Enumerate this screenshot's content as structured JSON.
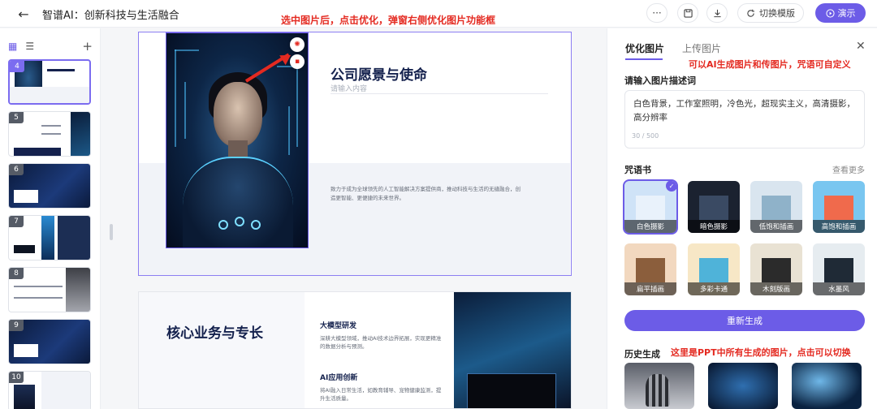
{
  "header": {
    "title": "智谱AI：创新科技与生活融合",
    "more_icon": "···",
    "switch_label": "切换模版",
    "present_label": "演示"
  },
  "annotations": {
    "top": "选中图片后，点击优化，弹窗右侧优化图片功能框",
    "right": "可以AI生成图片和传图片，咒语可自定义",
    "history": "这里是PPT中所有生成的图片，点击可以切换"
  },
  "thumbnails": [
    {
      "num": "4"
    },
    {
      "num": "5"
    },
    {
      "num": "6"
    },
    {
      "num": "7"
    },
    {
      "num": "8"
    },
    {
      "num": "9"
    },
    {
      "num": "10"
    }
  ],
  "slide1": {
    "title": "公司愿景与使命",
    "input_placeholder": "请输入内容",
    "description": "致力于成为全球领先的人工智能解决方案提供商，推动科技与生活的无缝融合，创造更智能、更便捷的未来世界。"
  },
  "slide2": {
    "title": "核心业务与专长",
    "item1_title": "大模型研发",
    "item1_text": "深耕大模型领域，推动AI技术边界拓展，实现更精准的数据分析与预测。",
    "item2_title": "AI应用创新",
    "item2_text": "将AI融入日常生活，如教育辅导、宠物健康监测，提升生活质量。"
  },
  "panel": {
    "tab_optimize": "优化图片",
    "tab_upload": "上传图片",
    "desc_label": "请输入图片描述词",
    "desc_value": "白色背景，工作室照明，冷色光，超现实主义，高清摄影，高分辨率",
    "counter": "30 / 500",
    "spellbook_label": "咒语书",
    "see_more": "查看更多",
    "styles": [
      {
        "label": "白色摄影",
        "bg": "#cfe3f7",
        "fg": "#e9f2fb"
      },
      {
        "label": "暗色摄影",
        "bg": "#1b2230",
        "fg": "#3a4a63"
      },
      {
        "label": "低饱和插画",
        "bg": "#d9e5ef",
        "fg": "#8fb2c9"
      },
      {
        "label": "高饱和插画",
        "bg": "#79c6f0",
        "fg": "#f06a4c"
      },
      {
        "label": "扁平插画",
        "bg": "#f2d8bf",
        "fg": "#8b5e3c"
      },
      {
        "label": "多彩卡通",
        "bg": "#f7e7c6",
        "fg": "#4fb3d9"
      },
      {
        "label": "木刻版画",
        "bg": "#e9e2d3",
        "fg": "#2b2b2b"
      },
      {
        "label": "水墨风",
        "bg": "#e6ecf0",
        "fg": "#1f2a36"
      }
    ],
    "regenerate_label": "重新生成",
    "history_label": "历史生成"
  }
}
